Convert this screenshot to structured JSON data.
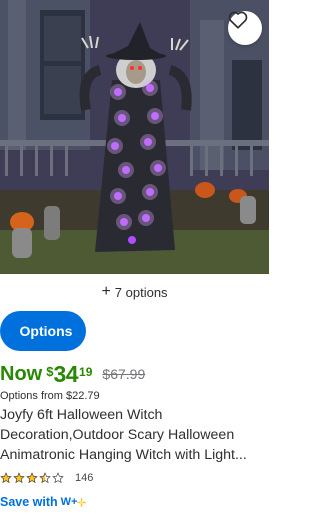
{
  "product": {
    "options_count_label": "7 options",
    "options_button_label": "Options",
    "price": {
      "now_label": "Now",
      "currency": "$",
      "whole": "34",
      "cents": "19",
      "was": "$67.99"
    },
    "options_from": "Options from $22.79",
    "title_lines": [
      "Joyfy 6ft Halloween Witch",
      "Decoration,Outdoor Scary Halloween",
      "Animatronic Hanging Witch with Light..."
    ],
    "rating": {
      "stars": 3.5,
      "max": 5,
      "review_count": "146"
    },
    "save_with_label": "Save with",
    "walmart_plus_label": "W+"
  },
  "colors": {
    "price_green": "#2a8703",
    "accent_blue": "#0071dc",
    "star_gold": "#ffc220",
    "text": "#2e2f32",
    "muted": "#74767c"
  },
  "icons": {
    "favorite": "heart-icon",
    "add": "plus-icon",
    "rating": "star-icon",
    "walmart_plus": "walmart-plus-icon"
  }
}
